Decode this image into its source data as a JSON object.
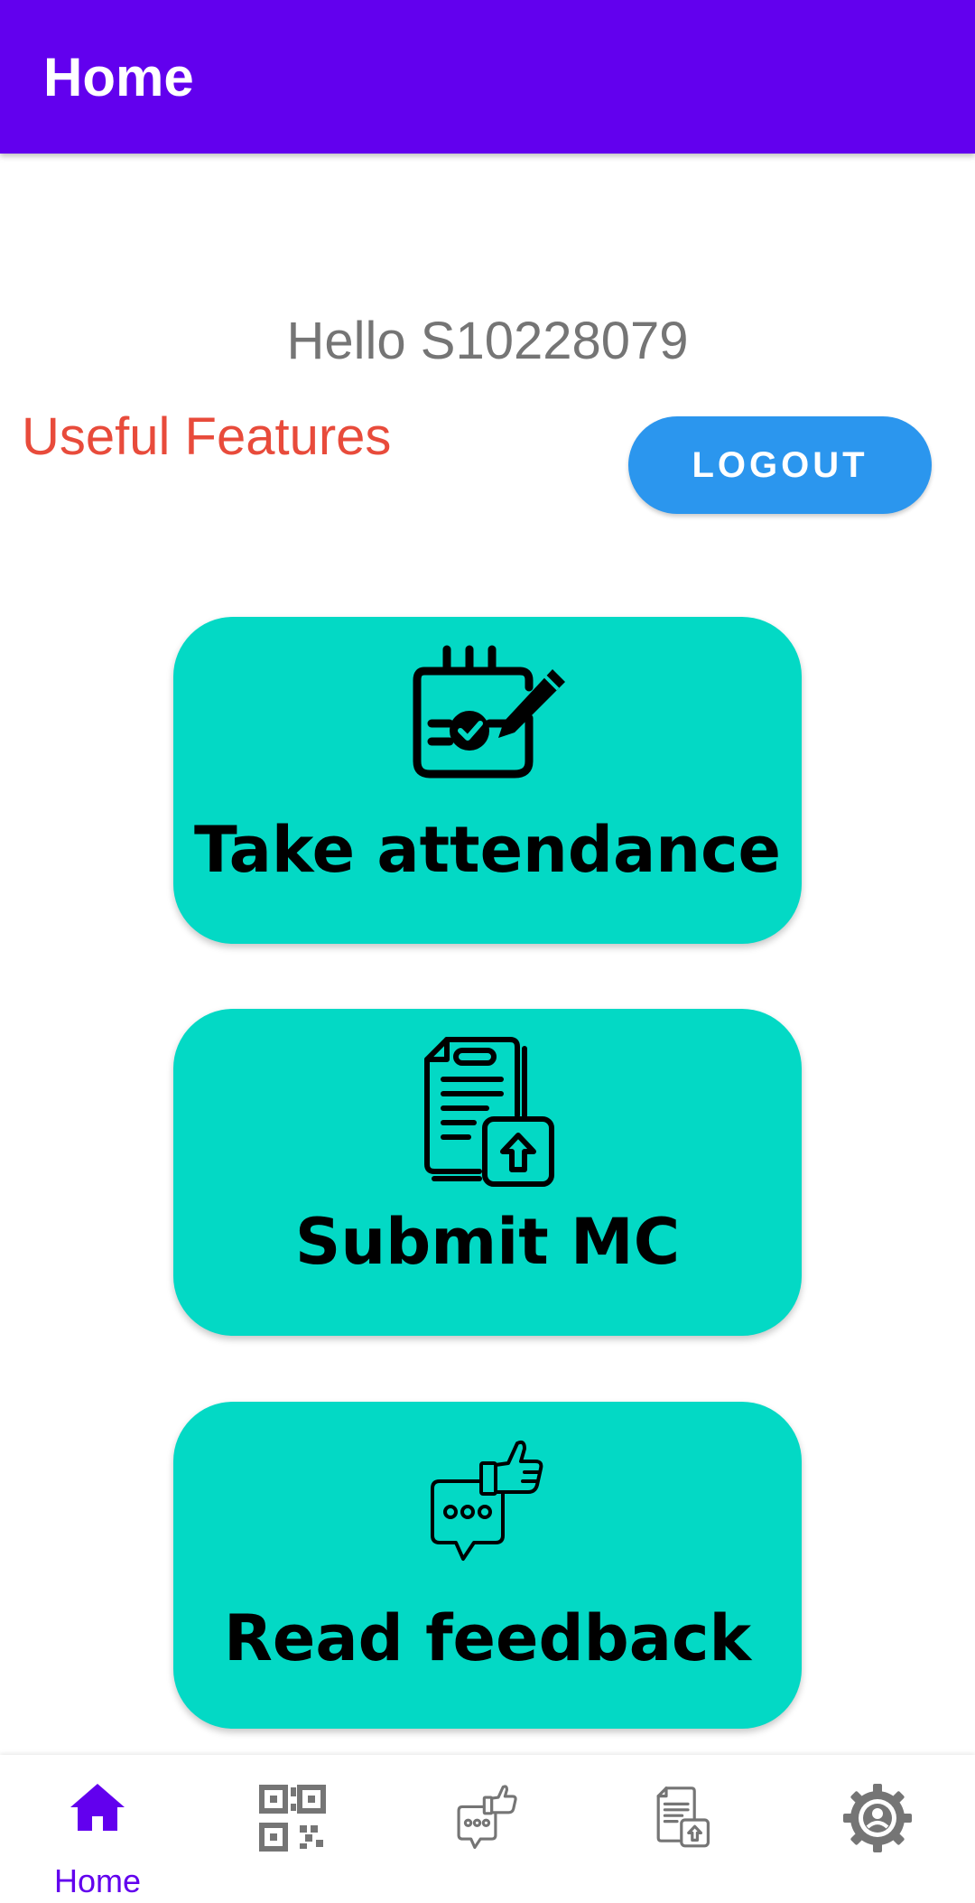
{
  "app_bar": {
    "title": "Home"
  },
  "greeting": "Hello S10228079",
  "section_title": "Useful Features",
  "logout_label": "LOGOUT",
  "features": [
    {
      "label": "Take attendance",
      "icon": "calendar-check-icon"
    },
    {
      "label": "Submit MC",
      "icon": "document-upload-icon"
    },
    {
      "label": "Read feedback",
      "icon": "feedback-thumbs-up-icon"
    }
  ],
  "bottom_nav": [
    {
      "label": "Home",
      "icon": "home-icon",
      "active": true
    },
    {
      "label": "",
      "icon": "qr-code-icon",
      "active": false
    },
    {
      "label": "",
      "icon": "feedback-icon",
      "active": false
    },
    {
      "label": "",
      "icon": "document-upload-icon",
      "active": false
    },
    {
      "label": "",
      "icon": "settings-icon",
      "active": false
    }
  ],
  "colors": {
    "primary": "#6200ee",
    "card": "#03d9c5",
    "logout": "#2b96ee",
    "section_title": "#e84b3b",
    "nav_inactive": "#757575"
  }
}
